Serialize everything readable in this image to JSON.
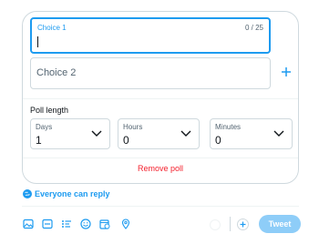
{
  "poll": {
    "choice1": {
      "label": "Choice 1",
      "counter": "0 / 25",
      "value": ""
    },
    "choice2": {
      "placeholder": "Choice 2"
    },
    "length_label": "Poll length",
    "days": {
      "label": "Days",
      "value": "1"
    },
    "hours": {
      "label": "Hours",
      "value": "0"
    },
    "minutes": {
      "label": "Minutes",
      "value": "0"
    },
    "remove_label": "Remove poll"
  },
  "reply_setting": {
    "label": "Everyone can reply"
  },
  "toolbar": {
    "icons": [
      "image-icon",
      "gif-icon",
      "poll-icon",
      "emoji-icon",
      "schedule-icon",
      "location-icon"
    ],
    "tweet_label": "Tweet"
  },
  "colors": {
    "accent": "#1d9bf0",
    "danger": "#f4212e",
    "border": "#cfd9de",
    "tweet_disabled": "#8ecdf8"
  }
}
